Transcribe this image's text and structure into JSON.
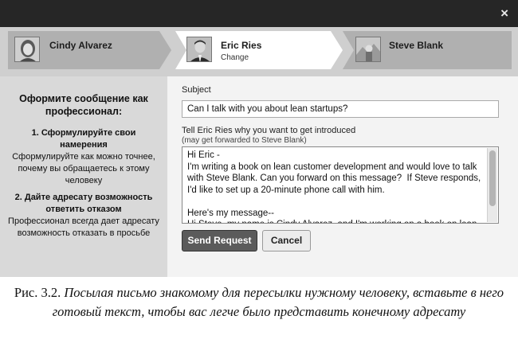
{
  "window": {
    "close_glyph": "×"
  },
  "steps": [
    {
      "name": "Cindy Alvarez",
      "sub": "",
      "state": "done"
    },
    {
      "name": "Eric Ries",
      "sub": "Change",
      "state": "current"
    },
    {
      "name": "Steve Blank",
      "sub": "",
      "state": "next"
    }
  ],
  "tips": {
    "title": "Оформите сообщение как профессионал:",
    "tip1": {
      "heading": "1. Сформулируйте свои намерения",
      "body": "Сформулируйте как можно точнее, почему вы обращаетесь к этому человеку"
    },
    "tip2": {
      "heading": "2. Дайте адресату возможность ответить отказом",
      "body": "Профессионал всегда дает адресату возможность отказать в просьбе"
    }
  },
  "form": {
    "subject_label": "Subject",
    "subject_value": "Can I talk with you about lean startups?",
    "message_label": "Tell Eric Ries why you want to get introduced",
    "message_sublabel": "(may get forwarded to Steve Blank)",
    "message_value": "Hi Eric -\nI'm writing a book on lean customer development and would love to talk with Steve Blank. Can you forward on this message?  If Steve responds, I'd like to set up a 20-minute phone call with him.\n\nHere's my message--\nHi Steve, my name is Cindy Alvarez, and I'm working on a book on lean"
  },
  "buttons": {
    "send": "Send Request",
    "cancel": "Cancel"
  },
  "caption": {
    "label": "Рис. 3.2.",
    "text": "Посылая письмо знакомому для пересылки нужному человеку, вставьте в него готовый текст, чтобы вас легче было представить конечному адресату"
  },
  "colors": {
    "topbar": "#262626",
    "send_button": "#5b5b5b",
    "tips_panel": "#d9d9d9"
  },
  "icons": [
    "close-icon",
    "avatar-cindy",
    "avatar-eric",
    "avatar-steve",
    "scrollbar"
  ]
}
